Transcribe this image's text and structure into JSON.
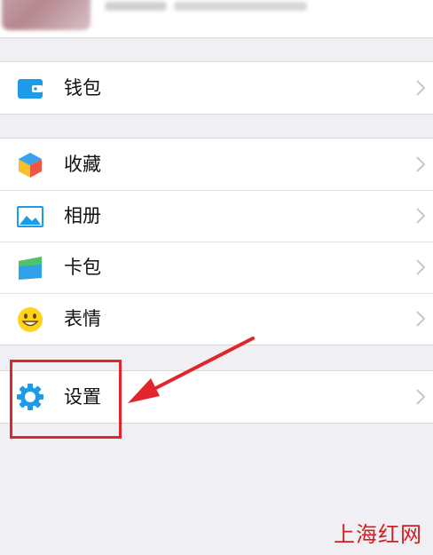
{
  "menu": {
    "wallet": {
      "label": "钱包",
      "icon": "wallet-icon"
    },
    "favorites": {
      "label": "收藏",
      "icon": "cube-icon"
    },
    "album": {
      "label": "相册",
      "icon": "picture-icon"
    },
    "cards": {
      "label": "卡包",
      "icon": "card-icon"
    },
    "stickers": {
      "label": "表情",
      "icon": "smiley-icon"
    },
    "settings": {
      "label": "设置",
      "icon": "gear-icon"
    }
  },
  "watermark": "上海红网",
  "colors": {
    "accent_blue": "#1d9be8",
    "annotation_red": "#e0262a",
    "background": "#efeff4"
  }
}
